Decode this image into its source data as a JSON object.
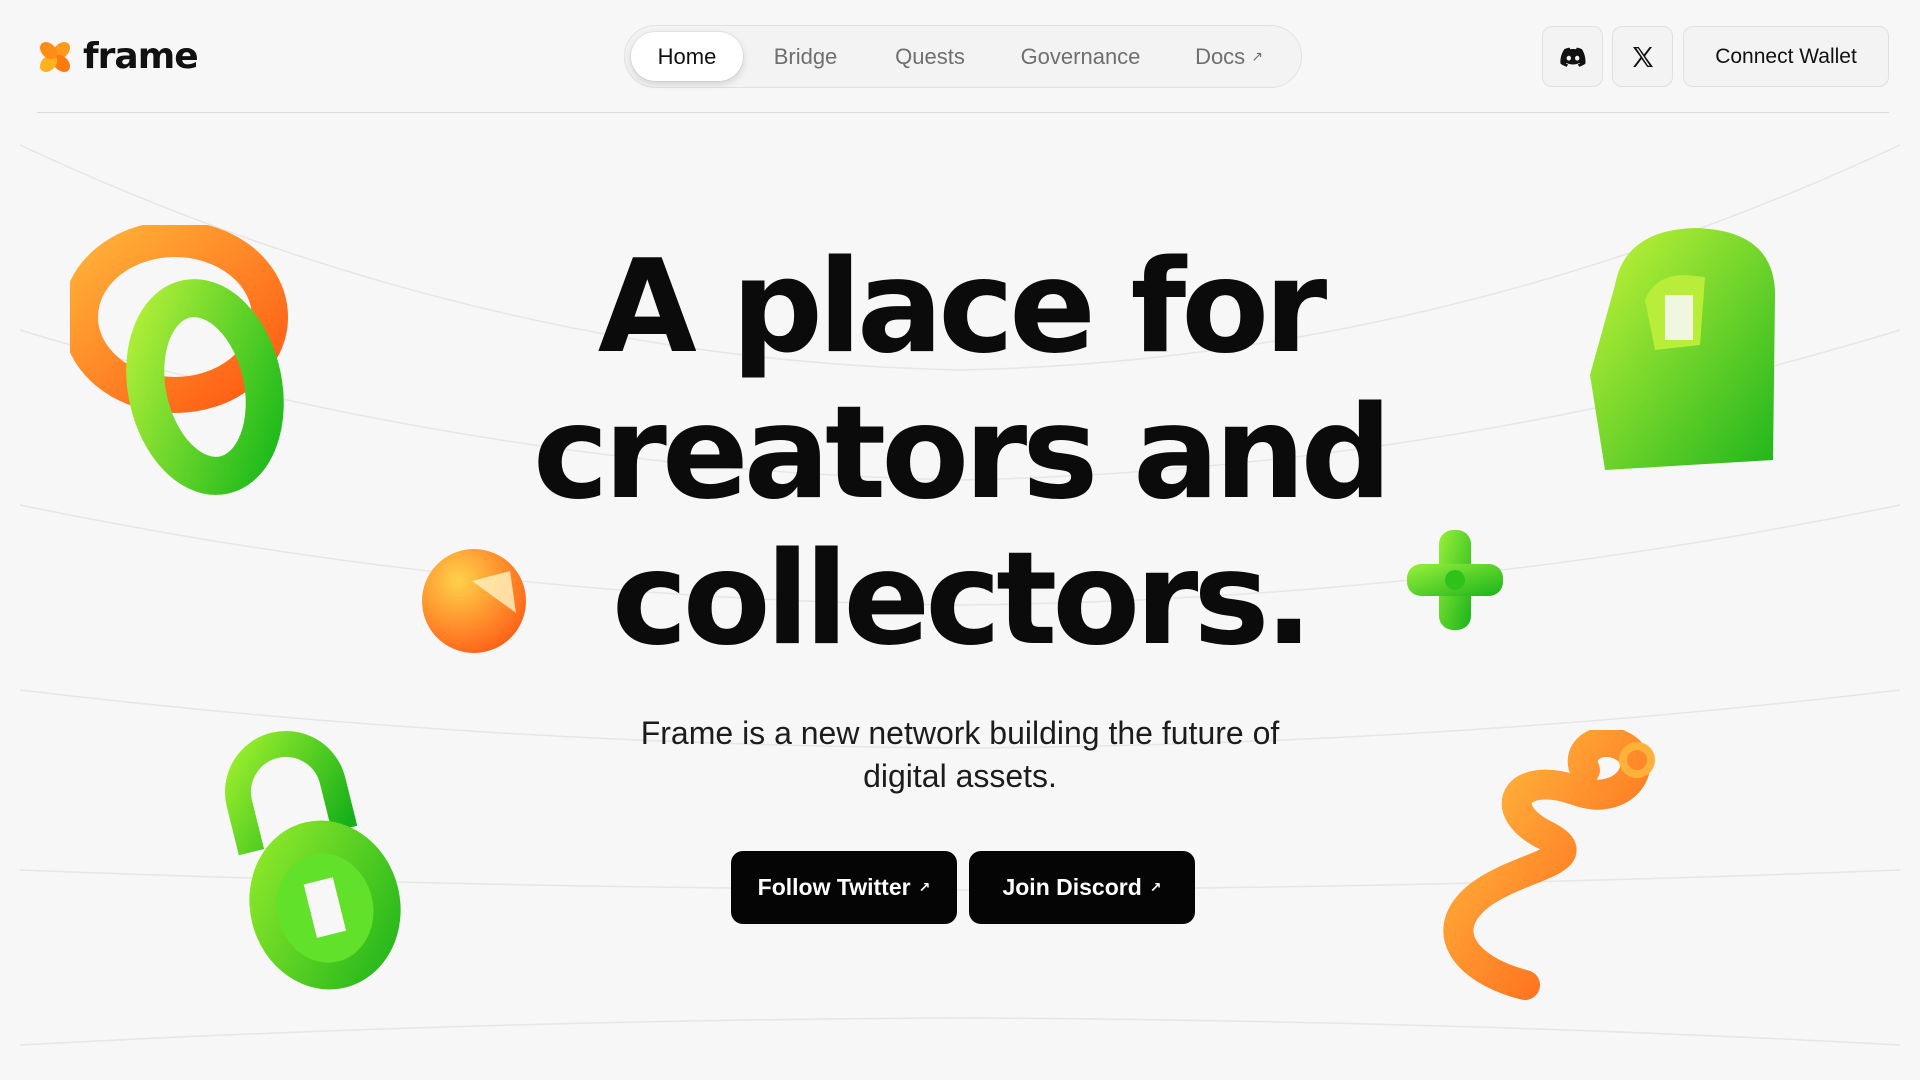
{
  "brand": {
    "name": "frame",
    "colors": {
      "orange": "#ff8a1f",
      "green": "#3ccf1a",
      "lime": "#8ee31a",
      "text": "#0b0b0b",
      "background": "#f7f7f7"
    }
  },
  "nav": {
    "items": [
      {
        "label": "Home",
        "active": true
      },
      {
        "label": "Bridge",
        "active": false
      },
      {
        "label": "Quests",
        "active": false
      },
      {
        "label": "Governance",
        "active": false
      },
      {
        "label": "Docs",
        "active": false,
        "external_icon": "↗"
      }
    ]
  },
  "header_actions": {
    "discord_icon": "discord-icon",
    "x_icon": "x-icon",
    "connect_label": "Connect Wallet"
  },
  "hero": {
    "title_lines": [
      "A place for",
      "creators and",
      "collectors."
    ],
    "subtitle_line1": "Frame is a new network building the future of",
    "subtitle_line2": "digital assets.",
    "buttons": [
      {
        "label": "Follow Twitter",
        "icon": "↗"
      },
      {
        "label": "Join Discord",
        "icon": "↗"
      }
    ]
  }
}
